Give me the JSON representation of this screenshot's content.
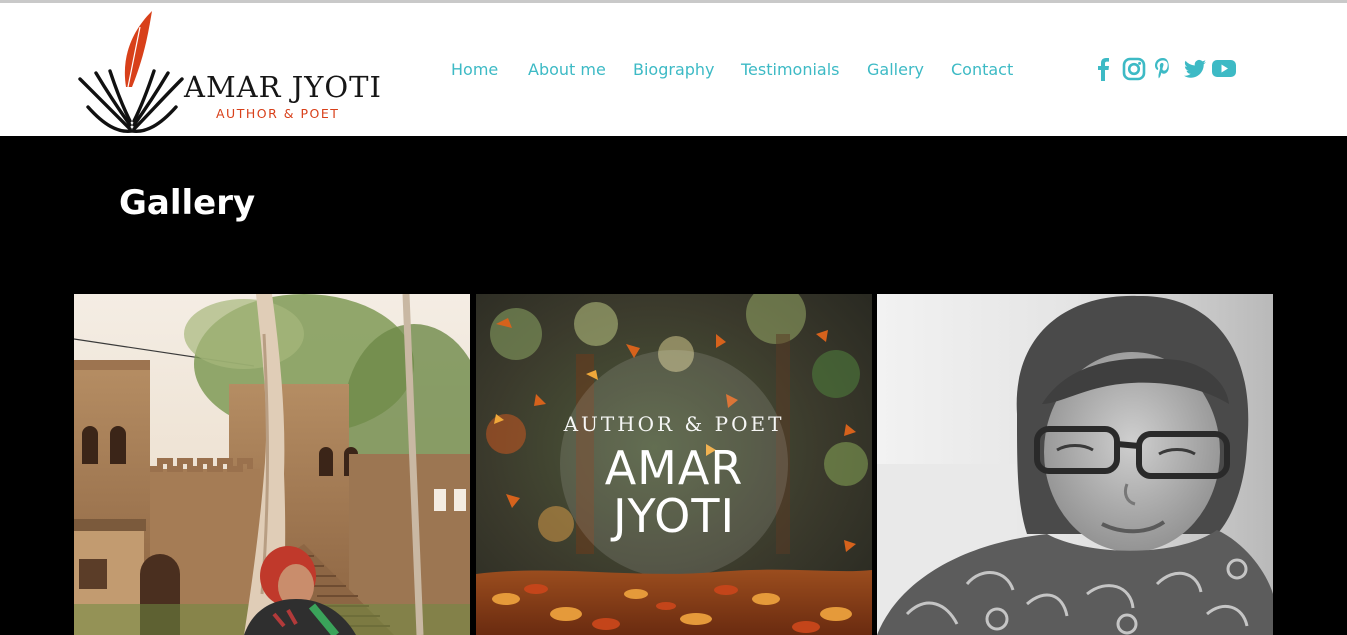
{
  "brand": {
    "name": "AMAR JYOTI",
    "tagline": "AUTHOR & POET",
    "accent": "#d8401a"
  },
  "nav": {
    "items": [
      "Home",
      "About me",
      "Biography",
      "Testimonials",
      "Gallery",
      "Contact"
    ],
    "color": "#3dbac5"
  },
  "social": [
    "facebook-icon",
    "instagram-icon",
    "pinterest-icon",
    "twitter-icon",
    "youtube-icon"
  ],
  "page": {
    "title": "Gallery"
  },
  "gallery": {
    "items": [
      {
        "kind": "photo",
        "subject": "woman-at-fort"
      },
      {
        "kind": "graphic",
        "subject": "autumn-leaves",
        "line1": "AUTHOR & POET",
        "line2": "AMAR",
        "line3": "JYOTI"
      },
      {
        "kind": "photo",
        "subject": "portrait-black-white"
      }
    ]
  }
}
